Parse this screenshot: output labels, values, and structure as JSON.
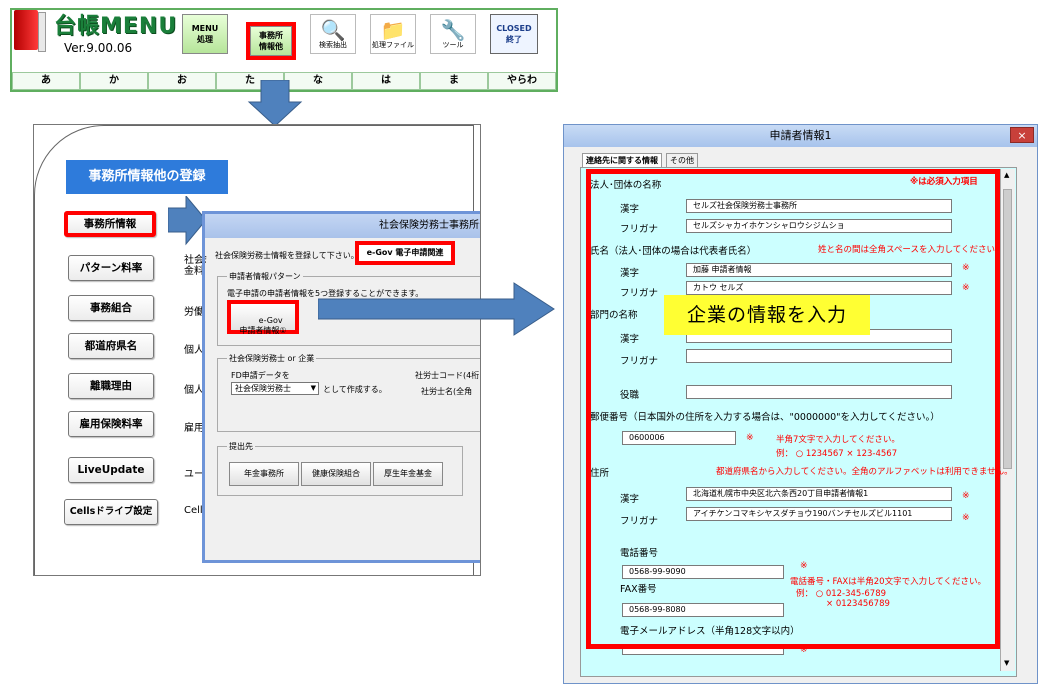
{
  "top_menu": {
    "app_title": "台帳MENU",
    "version": "Ver.9.00.06",
    "buttons": [
      {
        "label": "MENU\n処理",
        "icon": "menu-process-icon"
      },
      {
        "label": "事務所\n情報他",
        "icon": "office-info-icon"
      },
      {
        "label": "検索抽出",
        "icon": "search-icon"
      },
      {
        "label": "処理ファイル",
        "icon": "file-process-icon"
      },
      {
        "label": "ツール",
        "icon": "tool-icon"
      },
      {
        "label": "CLOSED\n終了",
        "icon": "closed-icon"
      }
    ],
    "kana_tabs": [
      "あ",
      "か",
      "お",
      "た",
      "な",
      "は",
      "ま",
      "やらわ"
    ]
  },
  "registration_panel": {
    "title": "事務所情報他の登録",
    "buttons": [
      {
        "label": "事務所情報",
        "desc": "社会"
      },
      {
        "label": "パターン料率",
        "desc": "社会\n金料"
      },
      {
        "label": "事務組合",
        "desc": "労働"
      },
      {
        "label": "都道府県名",
        "desc": "個人"
      },
      {
        "label": "離職理由",
        "desc": "個人"
      },
      {
        "label": "雇用保険料率",
        "desc": "雇用"
      },
      {
        "label": "LiveUpdate",
        "desc": "ユー"
      },
      {
        "label": "Cellsドライブ設定",
        "desc": "Cell"
      }
    ]
  },
  "office_dialog": {
    "title": "社会保険労務士事務所デ",
    "intro": "社会保険労務士情報を登録して下さい。",
    "egov_tab": "e-Gov 電子申請関連",
    "side_text": "会",
    "pattern_group": "申請者情報パターン",
    "pattern_desc": "電子申請の申請者情報を5つ登録することができます。",
    "egov_button": "e-Gov\n申請者情報①",
    "sharoushi_group": "社会保険労務士 or 企業",
    "fd_label": "FD申請データを",
    "fd_select": "社会保険労務士",
    "fd_suffix": "として作成する。",
    "code_label": "社労士コード(4桁",
    "name_label": "社労士名(全角",
    "submit_group": "提出先",
    "submit_buttons": [
      "年金事務所",
      "健康保険組合",
      "厚生年金基金"
    ]
  },
  "applicant_dialog": {
    "title": "申請者情報1",
    "close": "×",
    "tabs": [
      "連絡先に関する情報",
      "その他"
    ],
    "required_note": "※は必須入力項目",
    "callout": "企業の情報を入力",
    "sections": {
      "corp_name": "法人･団体の名称",
      "person_name": "氏名（法人･団体の場合は代表者氏名）",
      "person_note": "姓と名の間は全角スペースを入力してください。",
      "dept_name": "部門の名称",
      "position": "役職",
      "postal": "郵便番号（日本国外の住所を入力する場合は、\"0000000\"を入力してください。）",
      "postal_note1": "半角7文字で入力してください。",
      "postal_note2": "例：  ○  1234567    ×  123-4567",
      "address": "住所",
      "address_note": "都道府県名から入力してください。全角のアルファベットは利用できません。",
      "phone": "電話番号",
      "fax": "FAX番号",
      "phone_note1": "電話番号・FAXは半角20文字で入力してください。",
      "phone_note2": "例：  ○  012-345-6789",
      "phone_note3": "×  0123456789",
      "email": "電子メールアドレス（半角128文字以内）"
    },
    "sub_labels": {
      "kanji": "漢字",
      "furigana": "フリガナ"
    },
    "values": {
      "corp_kanji": "セルズ社会保険労務士事務所",
      "corp_kana": "セルズシャカイホケンシャロウシジムショ",
      "person_kanji": "加藤  申請者情報",
      "person_kana": "カトウ  セルズ",
      "dept_kanji": "",
      "dept_kana": "",
      "position": "",
      "postal": "0600006",
      "addr_kanji": "北海道札幌市中央区北六条西20丁目申請者情報1",
      "addr_kana": "アイチケンコマキシヤスダチョウ190バンチセルズビル1101",
      "phone": "0568-99-9090",
      "fax": "0568-99-8080",
      "email": ""
    },
    "star": "※"
  }
}
